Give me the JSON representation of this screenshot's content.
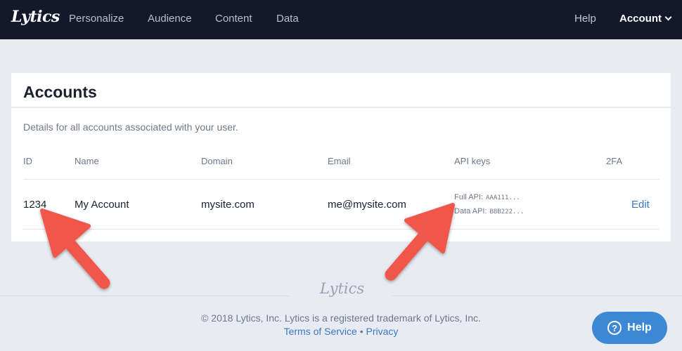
{
  "nav": {
    "logo": "Lytics",
    "items": [
      "Personalize",
      "Audience",
      "Content",
      "Data"
    ],
    "help": "Help",
    "account": "Account"
  },
  "accounts": {
    "title": "Accounts",
    "subtitle": "Details for all accounts associated with your user.",
    "columns": [
      "ID",
      "Name",
      "Domain",
      "Email",
      "API keys",
      "2FA"
    ],
    "rows": [
      {
        "id": "1234",
        "name": "My Account",
        "domain": "mysite.com",
        "email": "me@mysite.com",
        "full_api_label": "Full API:",
        "full_api_key": "AAA111...",
        "data_api_label": "Data API:",
        "data_api_key": "BBB222...",
        "action": "Edit"
      }
    ]
  },
  "footer": {
    "logo": "Lytics",
    "copyright": "© 2018 Lytics, Inc. Lytics is a registered trademark of Lytics, Inc.",
    "terms": "Terms of Service",
    "separator": "•",
    "privacy": "Privacy"
  },
  "help_button": {
    "icon": "question-circle-icon",
    "label": "Help"
  },
  "annotations": {
    "arrow_color": "#f0574a",
    "icons": [
      "arrow-to-id-icon",
      "arrow-to-api-keys-icon"
    ]
  }
}
